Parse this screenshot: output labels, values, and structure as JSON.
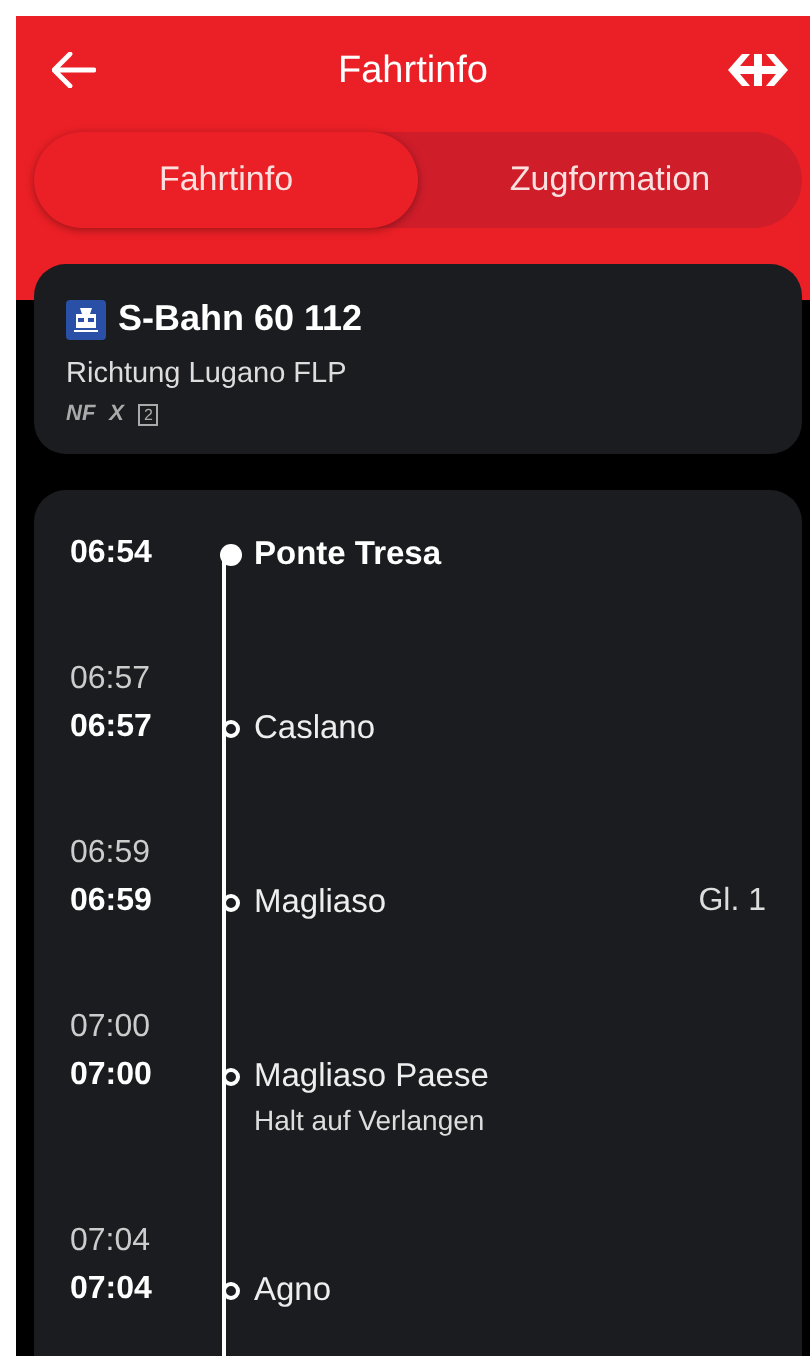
{
  "header": {
    "title": "Fahrtinfo"
  },
  "tabs": [
    {
      "label": "Fahrtinfo",
      "selected": true
    },
    {
      "label": "Zugformation",
      "selected": false
    }
  ],
  "train": {
    "name": "S-Bahn 60 112",
    "direction": "Richtung Lugano FLP",
    "attributes": [
      "NF",
      "X"
    ],
    "class_badge": "2"
  },
  "stops": [
    {
      "kind": "origin",
      "departure": "06:54",
      "name": "Ponte Tresa"
    },
    {
      "kind": "stop",
      "arrival": "06:57",
      "departure": "06:57",
      "name": "Caslano"
    },
    {
      "kind": "stop",
      "arrival": "06:59",
      "departure": "06:59",
      "name": "Magliaso",
      "platform": "Gl. 1"
    },
    {
      "kind": "stop",
      "arrival": "07:00",
      "departure": "07:00",
      "name": "Magliaso Paese",
      "note": "Halt auf Verlangen"
    },
    {
      "kind": "stop",
      "arrival": "07:04",
      "departure": "07:04",
      "name": "Agno"
    }
  ]
}
